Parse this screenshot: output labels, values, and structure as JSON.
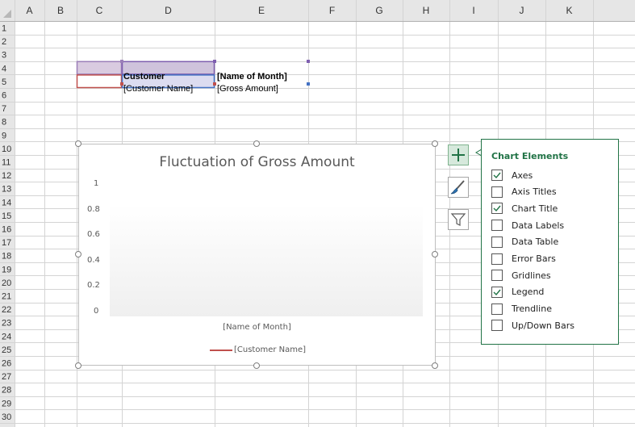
{
  "sheet": {
    "columns": [
      "A",
      "B",
      "C",
      "D",
      "E",
      "F",
      "G",
      "H",
      "I",
      "J",
      "K"
    ],
    "rows": [
      "1",
      "2",
      "3",
      "4",
      "5",
      "6",
      "7",
      "8",
      "9",
      "10",
      "11",
      "12",
      "13",
      "14",
      "15",
      "16",
      "17",
      "18",
      "19",
      "20",
      "21",
      "22",
      "23",
      "24",
      "25",
      "26",
      "27",
      "28",
      "29",
      "30"
    ],
    "cells": {
      "c4": "Customer",
      "d4": "[Name of Month]",
      "c5": "[Customer Name]",
      "d5": "[Gross Amount]"
    }
  },
  "chart": {
    "title": "Fluctuation of Gross Amount",
    "y_ticks": [
      "1",
      "0.8",
      "0.6",
      "0.4",
      "0.2",
      "0"
    ],
    "x_axis_label": "[Name of Month]",
    "legend_entry": "[Customer Name]",
    "series_color": "#c0504d"
  },
  "chart_data": {
    "type": "line",
    "title": "Fluctuation of Gross Amount",
    "xlabel": "",
    "ylabel": "",
    "ylim": [
      0,
      1
    ],
    "y_ticks": [
      0,
      0.2,
      0.4,
      0.6,
      0.8,
      1
    ],
    "categories": [
      "[Name of Month]"
    ],
    "series": [
      {
        "name": "[Customer Name]",
        "values": []
      }
    ],
    "legend": "bottom",
    "grid": false
  },
  "side_buttons": {
    "chart_elements": "chart-elements-plus-icon",
    "chart_styles": "brush-icon",
    "chart_filters": "filter-icon"
  },
  "chart_elements_panel": {
    "title": "Chart Elements",
    "options": [
      {
        "label": "Axes",
        "checked": true
      },
      {
        "label": "Axis Titles",
        "checked": false
      },
      {
        "label": "Chart Title",
        "checked": true
      },
      {
        "label": "Data Labels",
        "checked": false
      },
      {
        "label": "Data Table",
        "checked": false
      },
      {
        "label": "Error Bars",
        "checked": false
      },
      {
        "label": "Gridlines",
        "checked": false
      },
      {
        "label": "Legend",
        "checked": true
      },
      {
        "label": "Trendline",
        "checked": false
      },
      {
        "label": "Up/Down Bars",
        "checked": false
      }
    ]
  },
  "colors": {
    "header_fill": "#e6e6e6",
    "gridline": "#d4d4d4",
    "customer_header_fill": "#d9cbe0",
    "month_header_fill": "#cfc3dc",
    "value_fill": "#dcdcf0",
    "accent_green": "#217346"
  }
}
